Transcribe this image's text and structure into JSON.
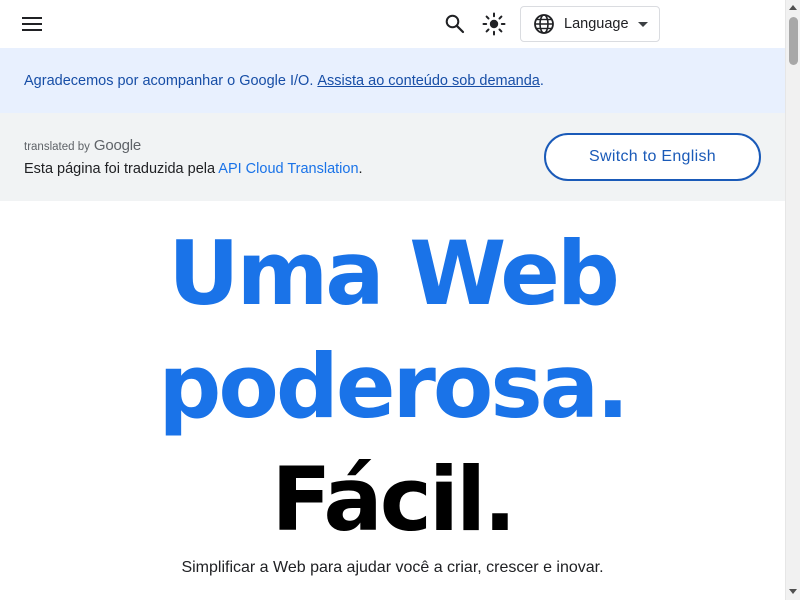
{
  "header": {
    "menu_icon": "hamburger-menu-icon",
    "search_icon": "search-icon",
    "theme_icon": "brightness-icon",
    "language_icon": "globe-icon",
    "language_label": "Language"
  },
  "announcement": {
    "text": "Agradecemos por acompanhar o Google I/O. ",
    "link": "Assista ao conteúdo sob demanda",
    "suffix": "."
  },
  "translation": {
    "translated_by": "translated by",
    "google": "Google",
    "note_prefix": "Esta página foi traduzida pela ",
    "note_link": "API Cloud Translation",
    "note_suffix": ".",
    "switch_button": "Switch to English"
  },
  "hero": {
    "line1": "Uma Web",
    "line2": "poderosa.",
    "line3": "Fácil.",
    "subtitle": "Simplificar a Web para ajudar você a criar, crescer e inovar."
  },
  "colors": {
    "accent": "#1a73e8",
    "banner_bg": "#e8f0fe",
    "translate_bg": "#f1f3f4",
    "headline_dark": "#000000"
  }
}
